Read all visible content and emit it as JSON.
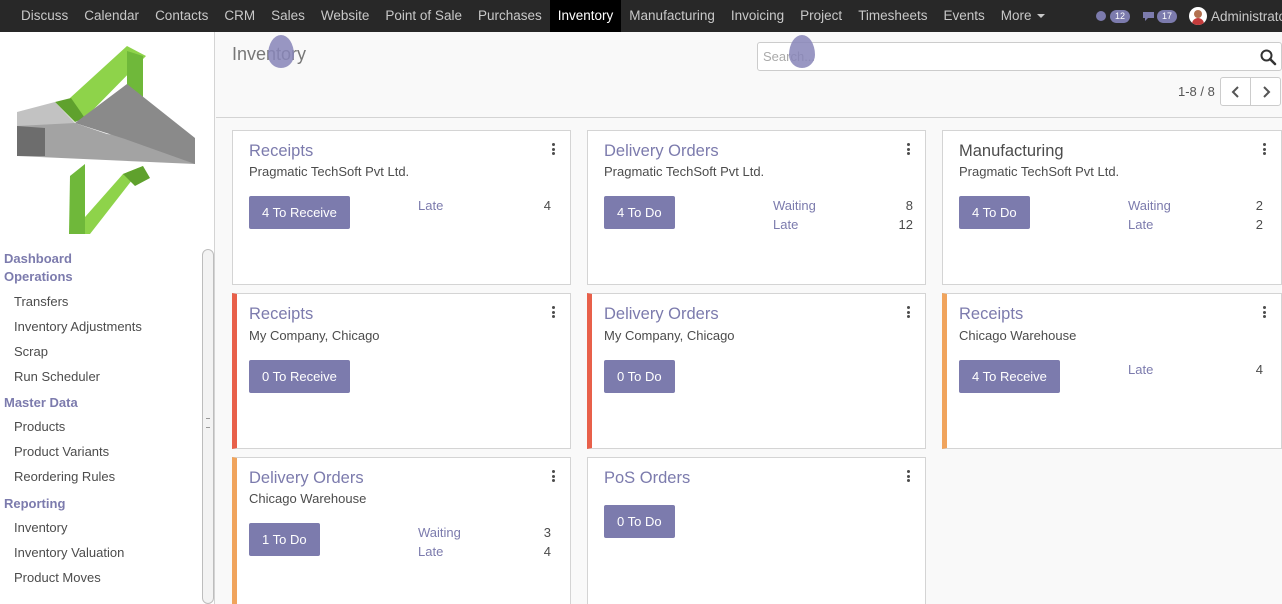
{
  "topbar": {
    "menu": [
      "Discuss",
      "Calendar",
      "Contacts",
      "CRM",
      "Sales",
      "Website",
      "Point of Sale",
      "Purchases",
      "Inventory",
      "Manufacturing",
      "Invoicing",
      "Project",
      "Timesheets",
      "Events",
      "More"
    ],
    "active": "Inventory",
    "activity_count": "12",
    "message_count": "17",
    "user": "Administrator"
  },
  "sidebar": {
    "dashboard": "Dashboard",
    "operations": "Operations",
    "operations_items": [
      "Transfers",
      "Inventory Adjustments",
      "Scrap",
      "Run Scheduler"
    ],
    "master_data": "Master Data",
    "master_items": [
      "Products",
      "Product Variants",
      "Reordering Rules"
    ],
    "reporting": "Reporting",
    "reporting_items": [
      "Inventory",
      "Inventory Valuation",
      "Product Moves"
    ]
  },
  "control": {
    "title": "Inventory",
    "search_placeholder": "Search...",
    "pager": "1-8 / 8"
  },
  "cards": [
    {
      "title": "Receipts",
      "subtitle": "Pragmatic TechSoft Pvt Ltd.",
      "button": "4 To Receive",
      "stats": [
        {
          "label": "Late",
          "value": "4"
        }
      ]
    },
    {
      "title": "Delivery Orders",
      "subtitle": "Pragmatic TechSoft Pvt Ltd.",
      "button": "4 To Do",
      "stats": [
        {
          "label": "Waiting",
          "value": "8"
        },
        {
          "label": "Late",
          "value": "12"
        }
      ]
    },
    {
      "title": "Manufacturing",
      "subtitle": "Pragmatic TechSoft Pvt Ltd.",
      "button": "4 To Do",
      "stats": [
        {
          "label": "Waiting",
          "value": "2"
        },
        {
          "label": "Late",
          "value": "2"
        }
      ]
    },
    {
      "title": "Receipts",
      "subtitle": "My Company, Chicago",
      "button": "0 To Receive",
      "stats": []
    },
    {
      "title": "Delivery Orders",
      "subtitle": "My Company, Chicago",
      "button": "0 To Do",
      "stats": []
    },
    {
      "title": "Receipts",
      "subtitle": "Chicago Warehouse",
      "button": "4 To Receive",
      "stats": [
        {
          "label": "Late",
          "value": "4"
        }
      ]
    },
    {
      "title": "Delivery Orders",
      "subtitle": "Chicago Warehouse",
      "button": "1 To Do",
      "stats": [
        {
          "label": "Waiting",
          "value": "3"
        },
        {
          "label": "Late",
          "value": "4"
        }
      ]
    },
    {
      "title": "PoS Orders",
      "subtitle": "",
      "button": "0 To Do",
      "stats": []
    }
  ],
  "colors": {
    "brand": "#7c7bad",
    "topbar": "#282828",
    "accent_red": "#e8604a",
    "accent_orange": "#f0a45d"
  }
}
